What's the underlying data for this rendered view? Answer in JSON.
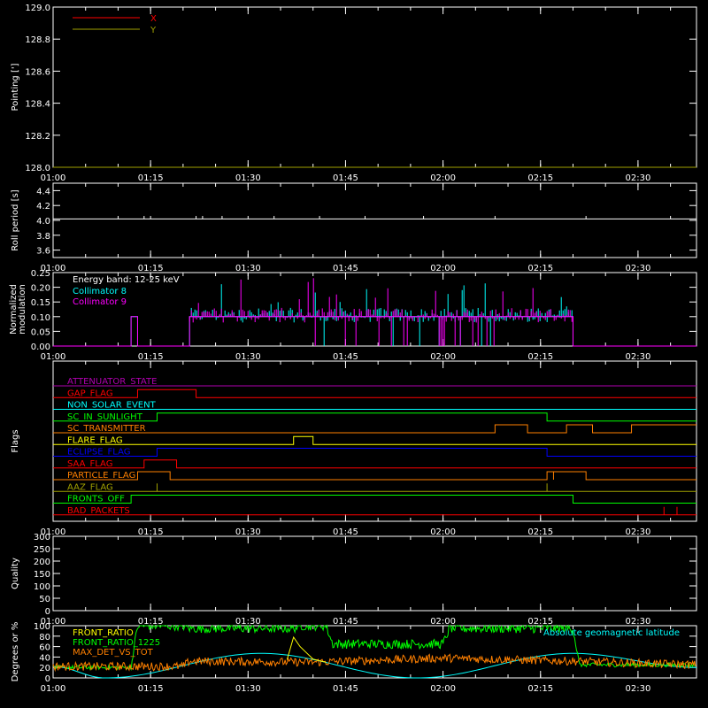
{
  "colors": {
    "background": "#000000",
    "axes": "#ffffff",
    "red": "#ff0000",
    "olive": "#a0a000",
    "cyan": "#00ffff",
    "magenta": "#ff00ff",
    "green": "#00ff00",
    "orange": "#ff8000",
    "yellow": "#ffff00",
    "blue": "#0000ff",
    "purple": "#b000b0",
    "white": "#ffffff"
  },
  "time_axis": {
    "start": "01:00",
    "end": "02:39",
    "ticks": [
      "01:00",
      "01:15",
      "01:30",
      "01:45",
      "02:00",
      "02:15",
      "02:30"
    ]
  },
  "chart_data": [
    {
      "type": "line",
      "ylabel": "Pointing [']",
      "ylim": [
        128.0,
        129.0
      ],
      "yticks": [
        "128.0",
        "128.2",
        "128.4",
        "128.6",
        "128.8",
        "129.0"
      ],
      "legend": {
        "placement": "top-left",
        "entries": [
          "X",
          "Y"
        ]
      },
      "series": [
        {
          "name": "X",
          "color": "red",
          "x": [],
          "y": []
        },
        {
          "name": "Y",
          "color": "olive",
          "x": [
            "01:00",
            "02:39"
          ],
          "y": [
            128.0,
            128.0
          ]
        }
      ]
    },
    {
      "type": "line",
      "ylabel": "Roll period [s]",
      "ylim": [
        3.5,
        4.5
      ],
      "yticks": [
        "3.6",
        "3.8",
        "4.0",
        "4.2",
        "4.4"
      ],
      "series": [
        {
          "color": "white",
          "x": [
            "01:00",
            "02:39"
          ],
          "y": [
            4.02,
            4.02
          ]
        }
      ]
    },
    {
      "type": "line",
      "ylabel": "Normalized modulation",
      "ylim": [
        0.0,
        0.25
      ],
      "yticks": [
        "0.00",
        "0.05",
        "0.10",
        "0.15",
        "0.20",
        "0.25"
      ],
      "annotation": "Energy band: 12-25 keV",
      "legend": {
        "placement": "top-left",
        "entries": [
          "Collimator 8",
          "Collimator 9"
        ]
      },
      "series": [
        {
          "name": "Collimator 8",
          "color": "cyan",
          "x": [
            "01:12",
            "01:13",
            "01:21",
            "01:21",
            "01:40",
            "01:55",
            "02:12",
            "02:20",
            "02:20"
          ],
          "y": [
            0.0,
            0.09,
            0.0,
            0.09,
            0.1,
            0.1,
            0.1,
            0.1,
            0.0
          ]
        },
        {
          "name": "Collimator 9",
          "color": "magenta",
          "x": [
            "01:12",
            "01:13",
            "01:21",
            "01:21",
            "01:40",
            "01:55",
            "02:12",
            "02:20",
            "02:20"
          ],
          "y": [
            0.0,
            0.1,
            0.0,
            0.1,
            0.1,
            0.1,
            0.1,
            0.1,
            0.0
          ]
        }
      ]
    },
    {
      "type": "line",
      "ylabel": "Flags",
      "series": [
        {
          "name": "ATTENUATOR_STATE",
          "color": "purple",
          "transitions": []
        },
        {
          "name": "GAP_FLAG",
          "color": "red",
          "transitions": [
            "01:13",
            "01:22"
          ]
        },
        {
          "name": "NON_SOLAR_EVENT",
          "color": "cyan",
          "transitions": []
        },
        {
          "name": "SC_IN_SUNLIGHT",
          "color": "green",
          "transitions": [
            "01:16",
            "02:16"
          ]
        },
        {
          "name": "SC_TRANSMITTER",
          "color": "orange",
          "transitions": [
            "02:08",
            "02:13",
            "02:13",
            "02:13",
            "02:19",
            "02:23",
            "02:29"
          ]
        },
        {
          "name": "FLARE_FLAG",
          "color": "yellow",
          "transitions": [
            "01:37",
            "01:40"
          ]
        },
        {
          "name": "ECLIPSE_FLAG",
          "color": "blue",
          "transitions": [
            "01:16",
            "02:16"
          ]
        },
        {
          "name": "SAA_FLAG",
          "color": "red",
          "transitions": [
            "01:14",
            "01:19"
          ]
        },
        {
          "name": "PARTICLE_FLAG",
          "color": "orange",
          "transitions": [
            "01:13",
            "01:18",
            "02:16",
            "02:17",
            "02:17",
            "02:22"
          ]
        },
        {
          "name": "AAZ_FLAG",
          "color": "olive",
          "transitions": [
            "01:16",
            "01:16",
            "02:16",
            "02:16"
          ]
        },
        {
          "name": "FRONTS_OFF",
          "color": "green",
          "transitions": [
            "01:12",
            "02:20"
          ]
        },
        {
          "name": "BAD_PACKETS",
          "color": "red",
          "transitions": [
            "02:34",
            "02:34",
            "02:36",
            "02:36"
          ]
        }
      ]
    },
    {
      "type": "line",
      "ylabel": "Quality",
      "ylim": [
        0,
        300
      ],
      "yticks": [
        "0",
        "50",
        "100",
        "150",
        "200",
        "250",
        "300"
      ],
      "series": []
    },
    {
      "type": "line",
      "ylabel": "Degrees or %",
      "ylim": [
        0,
        100
      ],
      "yticks": [
        "0",
        "20",
        "40",
        "60",
        "80",
        "100"
      ],
      "legend": {
        "placement": "top-left",
        "entries": [
          "FRONT_RATIO",
          "FRONT_RATIO_1225",
          "MAX_DET_VS_TOT"
        ]
      },
      "annotation": "Absolute geomagnetic latitude",
      "series": [
        {
          "name": "FRONT_RATIO",
          "color": "yellow",
          "x": [
            "01:36",
            "01:37",
            "01:38",
            "01:39",
            "01:40",
            "01:42"
          ],
          "y": [
            35,
            78,
            60,
            48,
            36,
            30
          ]
        },
        {
          "name": "FRONT_RATIO_1225",
          "color": "green",
          "x": [
            "01:12",
            "01:13",
            "01:20",
            "01:21",
            "01:37",
            "01:38",
            "01:42",
            "01:43",
            "02:00",
            "02:01",
            "02:20",
            "02:21",
            "02:39"
          ],
          "y": [
            20,
            100,
            100,
            95,
            95,
            100,
            100,
            65,
            65,
            95,
            95,
            25,
            25
          ]
        },
        {
          "name": "MAX_DET_VS_TOT",
          "color": "orange",
          "x": [
            "01:00",
            "01:20",
            "01:21",
            "01:40",
            "02:00",
            "02:20",
            "02:39"
          ],
          "y": [
            22,
            22,
            32,
            30,
            38,
            32,
            25
          ]
        },
        {
          "name": "Absolute geomagnetic latitude",
          "color": "cyan",
          "x": [
            "01:00",
            "01:08",
            "01:32",
            "01:56",
            "02:20",
            "02:39"
          ],
          "y": [
            22,
            0,
            47,
            0,
            47,
            20
          ]
        }
      ]
    }
  ]
}
